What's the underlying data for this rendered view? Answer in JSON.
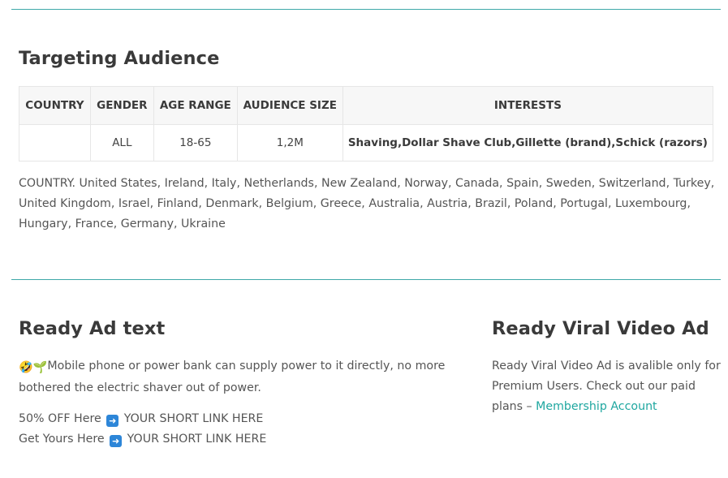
{
  "targeting": {
    "heading": "Targeting Audience",
    "table": {
      "headers": [
        "COUNTRY",
        "GENDER",
        "AGE RANGE",
        "AUDIENCE SIZE",
        "INTERESTS"
      ],
      "row": {
        "country": "",
        "gender": "ALL",
        "age_range": "18-65",
        "audience_size": "1,2M",
        "interests": "Shaving,Dollar Shave Club,Gillette (brand),Schick (razors)"
      }
    },
    "country_text": "COUNTRY. United States, Ireland, Italy, Netherlands, New Zealand, Norway, Canada, Spain, Sweden, Switzerland, Turkey, United Kingdom, Israel, Finland, Denmark, Belgium, Greece, Australia, Austria, Brazil, Poland, Portugal, Luxembourg, Hungary, France, Germany, Ukraine"
  },
  "ad_text": {
    "heading": "Ready Ad text",
    "emoji_1": "🤣",
    "emoji_2": "🌱",
    "body": "Mobile phone or power bank can supply power to it directly, no more bothered the electric shaver out of power.",
    "cta_1_prefix": "50% OFF Here",
    "cta_1_link": "YOUR SHORT LINK HERE",
    "cta_2_prefix": "Get Yours Here",
    "cta_2_link": "YOUR SHORT LINK HERE",
    "arrow_icon": "right-arrow-icon"
  },
  "video": {
    "heading": "Ready Viral Video Ad",
    "body": "Ready Viral Video Ad is avalible only for Premium Users. Check out our paid plans – ",
    "link_label": "Membership Account"
  },
  "colors": {
    "divider": "#3fa8a8",
    "link": "#1fa7a0",
    "arrow_box": "#2d86d8"
  }
}
